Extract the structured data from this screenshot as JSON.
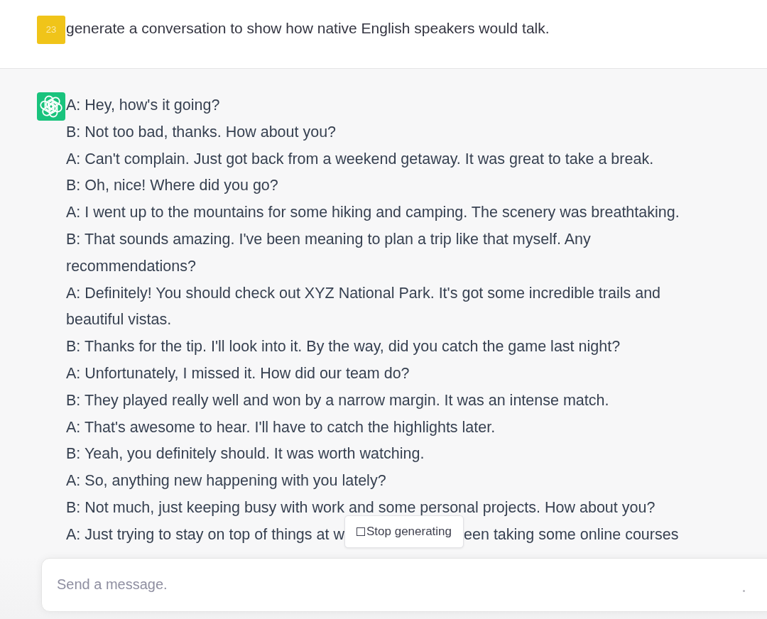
{
  "user_message": {
    "avatar_text": "23",
    "text": "generate a conversation to show how native English speakers would talk."
  },
  "assistant_message": {
    "lines": [
      "A: Hey, how's it going?",
      "B: Not too bad, thanks. How about you?",
      "A: Can't complain. Just got back from a weekend getaway. It was great to take a break.",
      "B: Oh, nice! Where did you go?",
      "A: I went up to the mountains for some hiking and camping. The scenery was breathtaking.",
      "B: That sounds amazing. I've been meaning to plan a trip like that myself. Any recommendations?",
      "A: Definitely! You should check out XYZ National Park. It's got some incredible trails and beautiful vistas.",
      "B: Thanks for the tip. I'll look into it. By the way, did you catch the game last night?",
      "A: Unfortunately, I missed it. How did our team do?",
      "B: They played really well and won by a narrow margin. It was an intense match.",
      "A: That's awesome to hear. I'll have to catch the highlights later.",
      "B: Yeah, you definitely should. It was worth watching.",
      "A: So, anything new happening with you lately?",
      "B: Not much, just keeping busy with work and some personal projects. How about you?"
    ],
    "last_line": {
      "before": "A: Just trying to stay on top of things at w",
      "after": "een taking some online courses"
    }
  },
  "stop_button": {
    "label": "Stop generating"
  },
  "composer": {
    "placeholder": "Send a message."
  }
}
